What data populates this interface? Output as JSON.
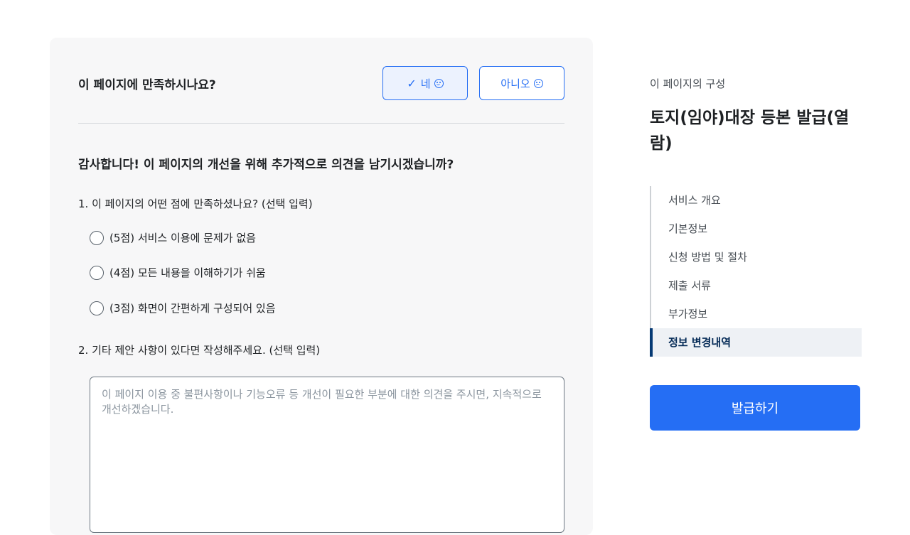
{
  "survey": {
    "question": "이 페이지에 만족하시나요?",
    "yes_label": "네",
    "no_label": "아니오",
    "thanks": "감사합니다! 이 페이지의 개선을 위해 추가적으로 의견을 남기시겠습니까?",
    "q1": "1. 이 페이지의 어떤 점에 만족하셨나요? (선택 입력)",
    "options": [
      "(5점) 서비스 이용에 문제가 없음",
      "(4점) 모든 내용을 이해하기가 쉬움",
      "(3점) 화면이 간편하게 구성되어 있음"
    ],
    "q2": "2. 기타 제안 사항이 있다면 작성해주세요. (선택 입력)",
    "comment_placeholder": "이 페이지 이용 중 불편사항이나 기능오류 등 개선이 필요한 부분에 대한 의견을 주시면, 지속적으로 개선하겠습니다."
  },
  "sidebar": {
    "caption": "이 페이지의 구성",
    "title": "토지(임야)대장 등본 발급(열람)",
    "items": [
      {
        "label": "서비스 개요"
      },
      {
        "label": "기본정보"
      },
      {
        "label": "신청 방법 및 절차"
      },
      {
        "label": "제출 서류"
      },
      {
        "label": "부가정보"
      },
      {
        "label": "정보 변경내역"
      }
    ],
    "issue_label": "발급하기"
  },
  "icons": {
    "yes": "check-icon",
    "yes_face": "smile-icon",
    "no_face": "frown-icon"
  },
  "colors": {
    "accent": "#256ef4",
    "active_nav": "#063a74"
  }
}
